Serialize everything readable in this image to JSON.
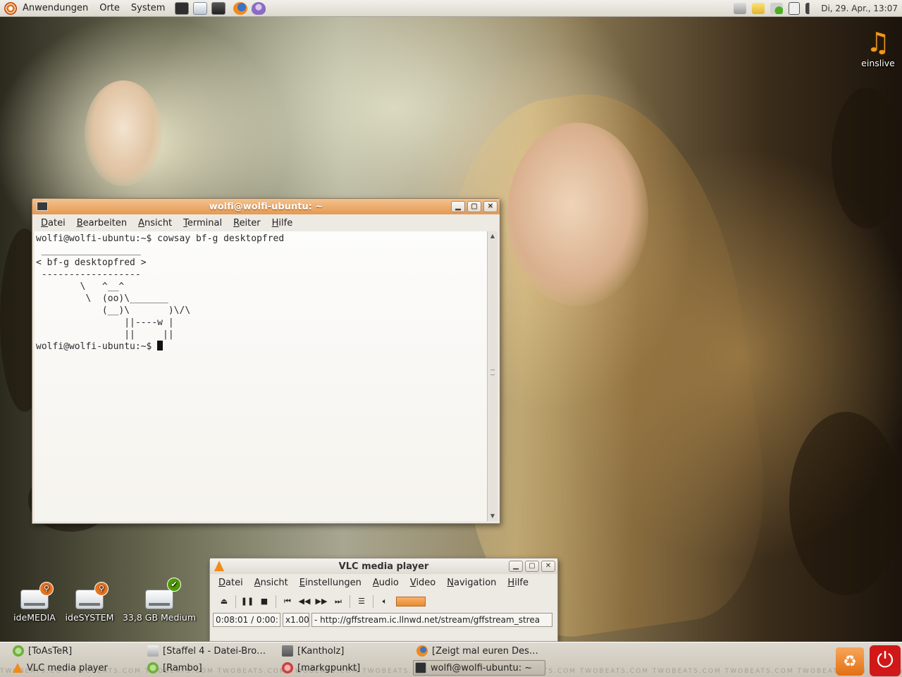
{
  "top_panel": {
    "menus": [
      "Anwendungen",
      "Orte",
      "System"
    ],
    "clock": "Di, 29. Apr., 13:07"
  },
  "desktop": {
    "icons": [
      {
        "label": "einslive"
      },
      {
        "label": "ideMEDIA"
      },
      {
        "label": "ideSYSTEM"
      },
      {
        "label": "33,8 GB Medium"
      }
    ]
  },
  "terminal": {
    "title": "wolfi@wolfi-ubuntu: ~",
    "menu": [
      "Datei",
      "Bearbeiten",
      "Ansicht",
      "Terminal",
      "Reiter",
      "Hilfe"
    ],
    "output": "wolfi@wolfi-ubuntu:~$ cowsay bf-g desktopfred\n __________________\n< bf-g desktopfred >\n ------------------\n        \\   ^__^\n         \\  (oo)\\_______\n            (__)\\       )\\/\\\n                ||----w |\n                ||     ||",
    "prompt": "wolfi@wolfi-ubuntu:~$ "
  },
  "vlc": {
    "title": "VLC media player",
    "menu": [
      "Datei",
      "Ansicht",
      "Einstellungen",
      "Audio",
      "Video",
      "Navigation",
      "Hilfe"
    ],
    "time": "0:08:01 / 0:00:",
    "speed": "x1.00",
    "stream": "- http://gffstream.ic.llnwd.net/stream/gffstream_strea"
  },
  "taskbar": {
    "row1": [
      "[ToAsTeR]",
      "[Staffel 4 - Datei-Bro…",
      "[Kantholz]",
      "[Zeigt mal euren Des…"
    ],
    "row2": [
      "VLC media player",
      "[Rambo]",
      "[markgpunkt]",
      "wolfi@wolfi-ubuntu: ~"
    ],
    "watermark": "TWOBEATS.COM TWOBEATS.COM TWOBEATS.COM TWOBEATS.COM TWOBEATS.COM TWOBEATS.COM TWOBEATS.COM TWOBEATS.COM TWOBEATS.COM TWOBEATS.COM TWOBEATS.COM TWOBEATS.COM TWOBEATS.COM"
  },
  "colors": {
    "accent": "#e49a52",
    "vlc_orange": "#f28a1a"
  }
}
